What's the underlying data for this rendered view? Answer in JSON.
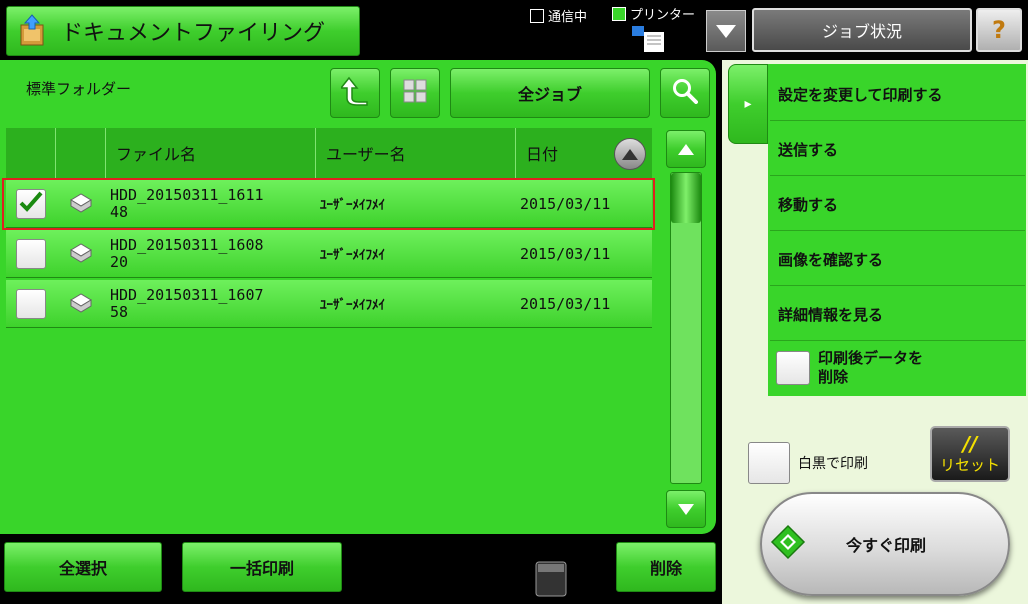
{
  "header": {
    "title": "ドキュメントファイリング",
    "status_comm": "通信中",
    "status_printer": "プリンター",
    "job_status_label": "ジョブ状況"
  },
  "folder": {
    "name": "標準フォルダー",
    "all_jobs_label": "全ジョブ"
  },
  "table": {
    "headers": {
      "filename": "ファイル名",
      "user": "ユーザー名",
      "date": "日付"
    },
    "rows": [
      {
        "file_line1": "HDD_20150311_1611",
        "file_line2": "48",
        "user": "ﾕｰｻﾞｰﾒｲﾌﾒｲ",
        "date": "2015/03/11",
        "checked": true
      },
      {
        "file_line1": "HDD_20150311_1608",
        "file_line2": "20",
        "user": "ﾕｰｻﾞｰﾒｲﾌﾒｲ",
        "date": "2015/03/11",
        "checked": false
      },
      {
        "file_line1": "HDD_20150311_1607",
        "file_line2": "58",
        "user": "ﾕｰｻﾞｰﾒｲﾌﾒｲ",
        "date": "2015/03/11",
        "checked": false
      }
    ]
  },
  "bottom": {
    "select_all": "全選択",
    "batch_print": "一括印刷",
    "delete": "削除"
  },
  "menu": {
    "items": [
      "設定を変更して印刷する",
      "送信する",
      "移動する",
      "画像を確認する",
      "詳細情報を見る"
    ],
    "delete_after_print_line1": "印刷後データを",
    "delete_after_print_line2": "削除"
  },
  "print_options": {
    "mono_print": "白黒で印刷",
    "reset_label": "リセット",
    "reset_glyph": "//",
    "print_now": "今すぐ印刷"
  },
  "colors": {
    "accent_green": "#3fce2d",
    "selection_outline": "#e02020",
    "reset_yellow": "#f4e000"
  }
}
